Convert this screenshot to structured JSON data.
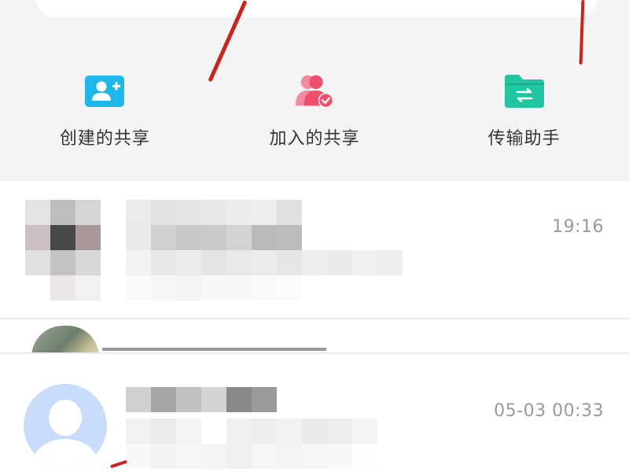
{
  "quick_actions": [
    {
      "label": "创建的共享",
      "icon": "add-user-icon",
      "color": "#1fb7ea"
    },
    {
      "label": "加入的共享",
      "icon": "joined-users-check-icon",
      "color": "#f0506e"
    },
    {
      "label": "传输助手",
      "icon": "folder-transfer-icon",
      "color": "#20c6a0"
    }
  ],
  "share_list": [
    {
      "time": "19:16",
      "name": "",
      "preview": ""
    },
    {
      "time": "",
      "name": "",
      "preview": ""
    },
    {
      "time": "05-03 00:33",
      "name": "",
      "preview": ""
    }
  ],
  "colors": {
    "annotation_red": "#c8231e",
    "background_gray": "#f4f4f4",
    "time_gray": "#9a9a9a"
  }
}
